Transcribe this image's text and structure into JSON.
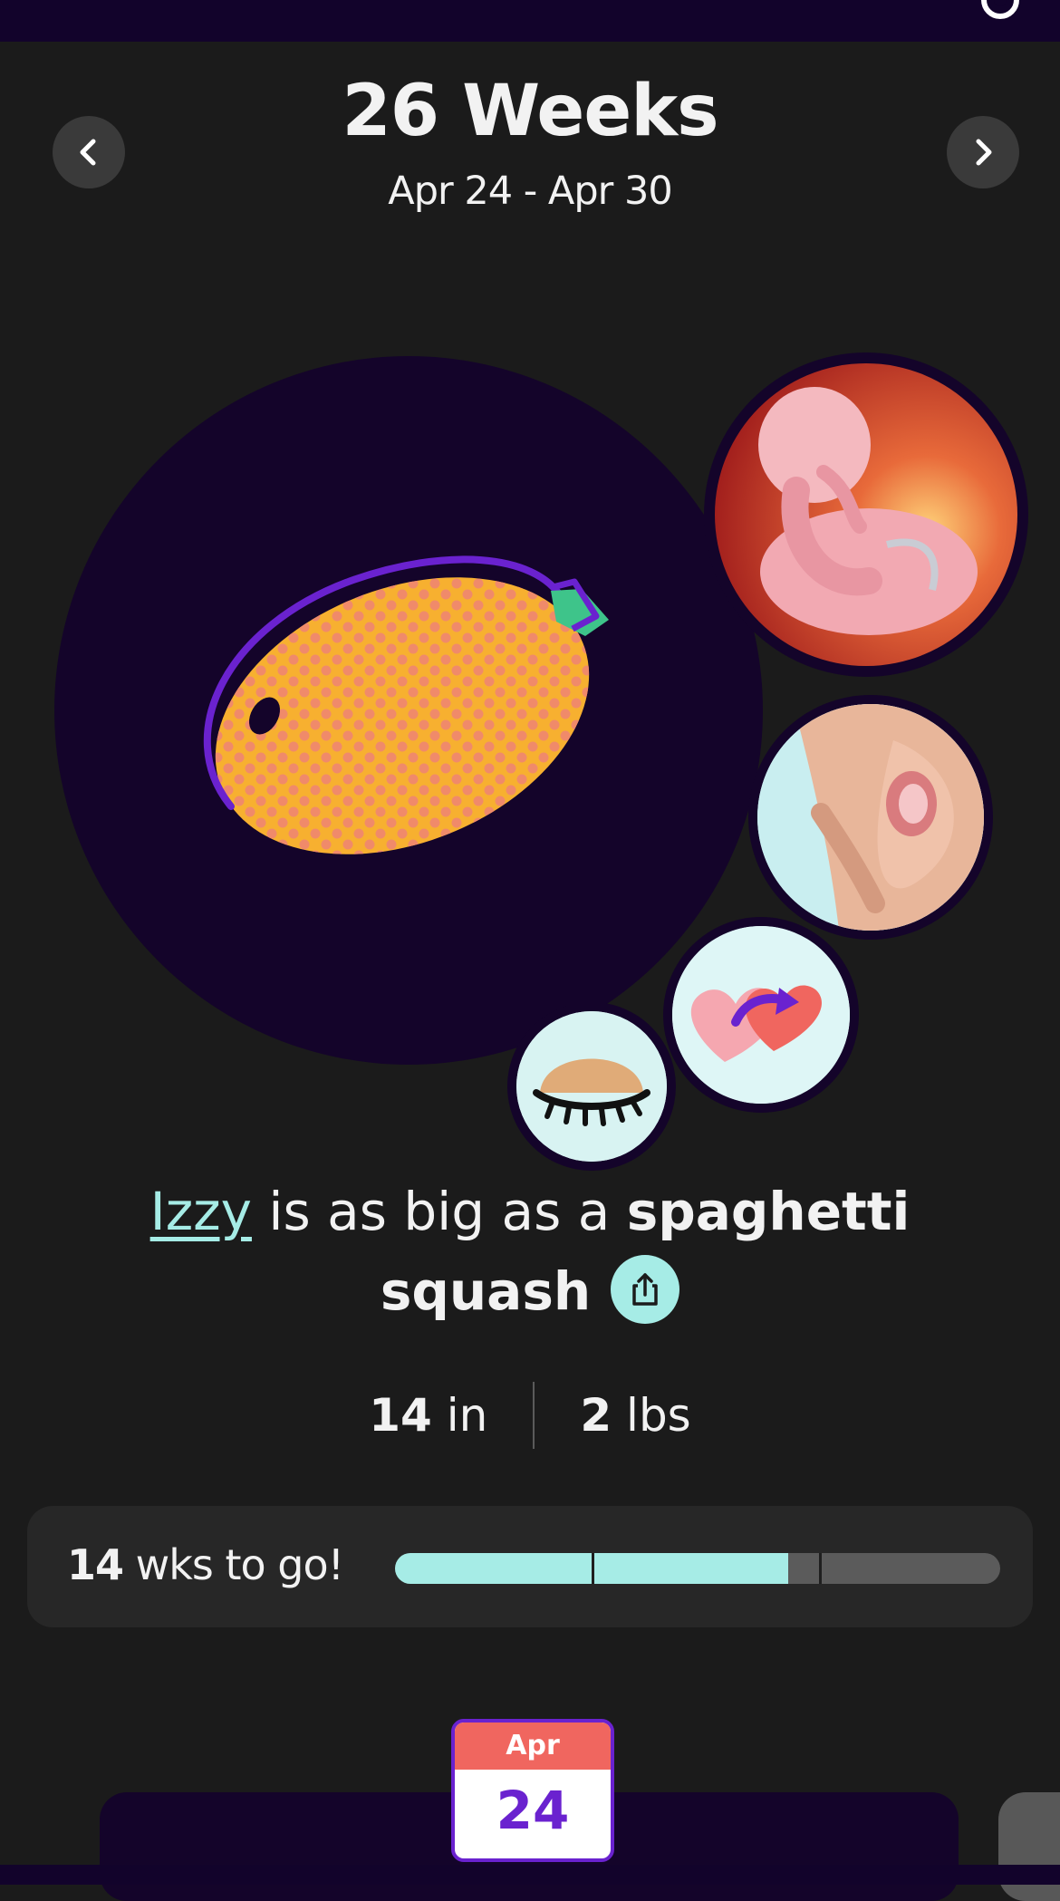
{
  "header": {
    "title": "26 Weeks",
    "date_range": "Apr 24 - Apr 30"
  },
  "size_comparison": {
    "baby_name": "Izzy",
    "connector": " is as big as a ",
    "fruit": "spaghetti squash"
  },
  "metrics": {
    "length_value": "14",
    "length_unit": "in",
    "weight_value": "2",
    "weight_unit": "lbs"
  },
  "progress": {
    "weeks_left": "14",
    "label": "wks to go!",
    "fraction_complete": 0.65,
    "trimester_marks": [
      0.325,
      0.7
    ]
  },
  "calendar": {
    "month": "Apr",
    "day": "24"
  },
  "colors": {
    "accent_teal": "#a6ece6",
    "deep_purple": "#14042a",
    "brand_purple": "#6a22cf",
    "coral": "#f0665f"
  },
  "icons": {
    "prev": "chevron-left-icon",
    "next": "chevron-right-icon",
    "share": "share-icon",
    "settings": "gear-icon"
  }
}
